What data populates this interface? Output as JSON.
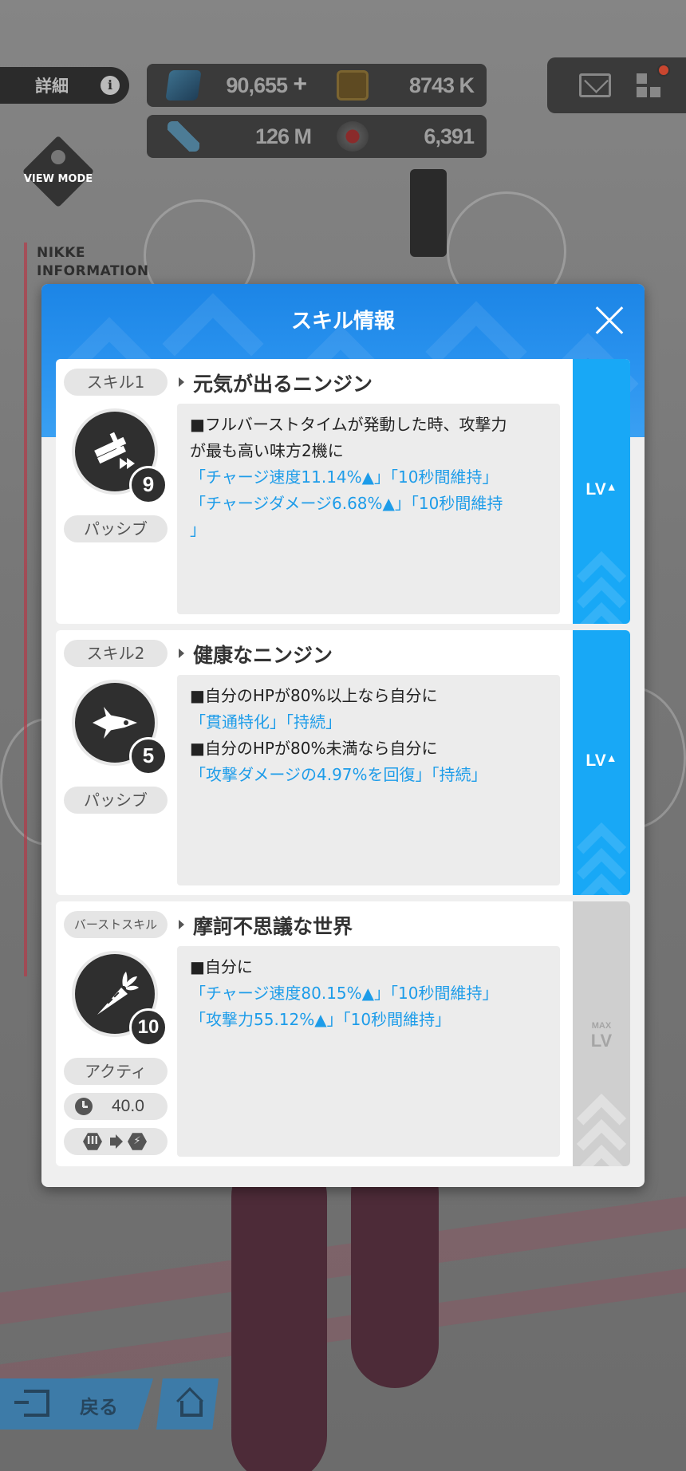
{
  "hud": {
    "detail_label": "詳細",
    "info_glyph": "i",
    "resources": [
      {
        "icon": "gem-icon",
        "value": "90,655",
        "plus": "+"
      },
      {
        "icon": "credit-card-icon",
        "value": "8743 K"
      },
      {
        "icon": "battle-data-icon",
        "value": "126 M"
      },
      {
        "icon": "core-dust-icon",
        "value": "6,391"
      }
    ],
    "view_mode_label": "VIEW MODE",
    "nikke_info_label": "NIKKE INFORMATION"
  },
  "modal": {
    "title": "スキル情報",
    "skills": [
      {
        "tag": "スキル1",
        "name": "元気が出るニンジン",
        "icon": "charge-speed-icon",
        "level": "9",
        "type": "パッシブ",
        "lines": [
          {
            "text": "■フルバーストタイムが発動した時、攻撃力",
            "hi": false
          },
          {
            "text": "が最も高い味方2機に",
            "hi": false
          },
          {
            "text": "「チャージ速度11.14%▲」「10秒間維持」",
            "hi": true
          },
          {
            "text": "「チャージダメージ6.68%▲」「10秒間維持",
            "hi": true
          },
          {
            "text": "」",
            "hi": true
          }
        ],
        "lv_label": "LV",
        "lv_state": "upgradeable"
      },
      {
        "tag": "スキル2",
        "name": "健康なニンジン",
        "icon": "pierce-icon",
        "level": "5",
        "type": "パッシブ",
        "lines": [
          {
            "text": "■自分のHPが80%以上なら自分に",
            "hi": false
          },
          {
            "text": "「貫通特化」「持続」",
            "hi": true
          },
          {
            "text": "■自分のHPが80%未満なら自分に",
            "hi": false
          },
          {
            "text": "「攻撃ダメージの4.97%を回復」「持続」",
            "hi": true
          }
        ],
        "lv_label": "LV",
        "lv_state": "upgradeable"
      },
      {
        "tag": "バーストスキル",
        "name": "摩訶不思議な世界",
        "icon": "carrot-icon",
        "level": "10",
        "type": "アクティ",
        "cooldown": "40.0",
        "burst_from": "III",
        "lines": [
          {
            "text": "■自分に",
            "hi": false
          },
          {
            "text": "「チャージ速度80.15%▲」「10秒間維持」",
            "hi": true
          },
          {
            "text": "「攻撃力55.12%▲」「10秒間維持」",
            "hi": true
          }
        ],
        "lv_small": "MAX",
        "lv_label": "LV",
        "lv_state": "max"
      }
    ]
  },
  "nav": {
    "back_label": "戻る"
  },
  "colors": {
    "header_blue": "#2a93ef",
    "level_side_blue": "#18a8f6",
    "highlight_text": "#1d9ce9",
    "notification_red": "#e3262a"
  }
}
